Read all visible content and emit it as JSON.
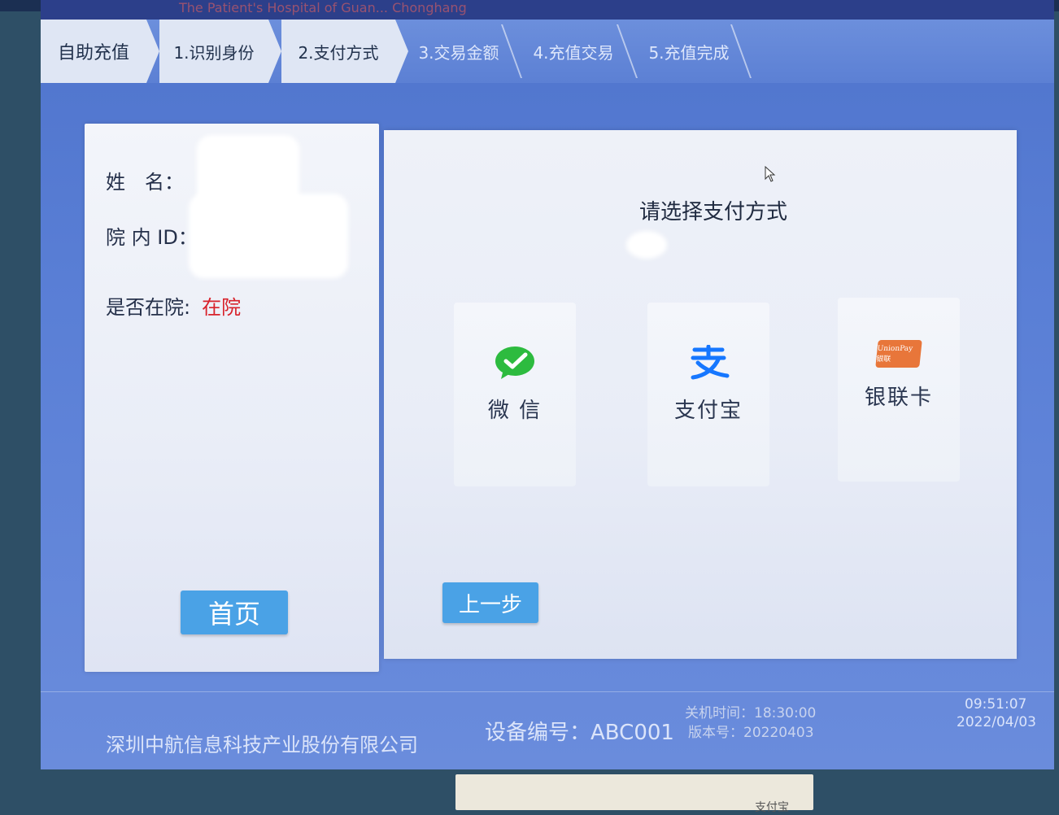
{
  "header": {
    "hospital_name": "The Patient's Hospital of Guan... Chonghang"
  },
  "steps": [
    {
      "label": "自助充值"
    },
    {
      "label": "1.识别身份"
    },
    {
      "label": "2.支付方式"
    },
    {
      "label": "3.交易金额"
    },
    {
      "label": "4.充值交易"
    },
    {
      "label": "5.充值完成"
    }
  ],
  "patient": {
    "name_label": "姓　名：",
    "id_label": "院 内 ID：",
    "status_label": "是否在院:",
    "status_value": "在院"
  },
  "left_panel": {
    "home_button": "首页"
  },
  "payment": {
    "prompt": "请选择支付方式",
    "methods": [
      {
        "label": "微 信",
        "icon": "wechat-icon"
      },
      {
        "label": "支付宝",
        "icon": "alipay-icon"
      },
      {
        "label": "银联卡",
        "icon": "unionpay-icon"
      }
    ],
    "back_button": "上一步",
    "unionpay_logo_text": "UnionPay 银联"
  },
  "footer": {
    "company": "深圳中航信息科技产业股份有限公司",
    "device": "设备编号：ABC001",
    "shutdown_time": "关机时间：18:30:00",
    "version": "版本号：20220403",
    "clock_time": "09:51:07",
    "clock_date": "2022/04/03"
  },
  "paper_note": "支付宝"
}
